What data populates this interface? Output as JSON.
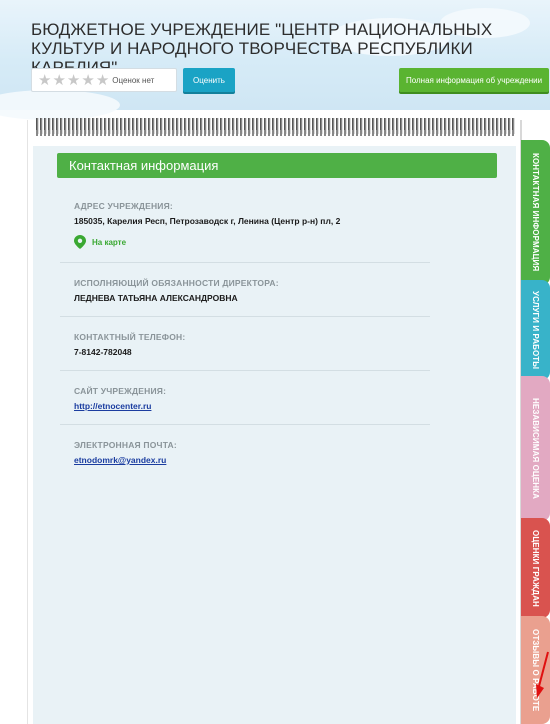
{
  "header": {
    "org_title": "БЮДЖЕТНОЕ УЧРЕЖДЕНИЕ \"ЦЕНТР НАЦИОНАЛЬНЫХ КУЛЬТУР И НАРОДНОГО ТВОРЧЕСТВА РЕСПУБЛИКИ КАРЕЛИЯ\"",
    "rating_text": "Оценок нет",
    "rating_value": 0,
    "rating_max": 5,
    "rate_button_label": "Оценить",
    "full_info_button_label": "Полная информация об учреждении"
  },
  "contact": {
    "section_title": "Контактная информация",
    "address_label": "АДРЕС УЧРЕЖДЕНИЯ:",
    "address_value": "185035, Карелия Респ, Петрозаводск г, Ленина (Центр р-н) пл, 2",
    "map_link_label": "На карте",
    "director_label": "ИСПОЛНЯЮЩИЙ ОБЯЗАННОСТИ ДИРЕКТОРА:",
    "director_value": "ЛЕДНЕВА ТАТЬЯНА АЛЕКСАНДРОВНА",
    "phone_label": "КОНТАКТНЫЙ ТЕЛЕФОН:",
    "phone_value": "7-8142-782048",
    "site_label": "САЙТ УЧРЕЖДЕНИЯ:",
    "site_value": "http://etnocenter.ru",
    "email_label": "ЭЛЕКТРОННАЯ ПОЧТА:",
    "email_value": "etnodomrk@yandex.ru"
  },
  "tabs": [
    {
      "label": "КОНТАКТНАЯ ИНФОРМАЦИЯ",
      "color": "#4fb046"
    },
    {
      "label": "УСЛУГИ И РАБОТЫ",
      "color": "#38b3c9"
    },
    {
      "label": "НЕЗАВИСИМАЯ ОЦЕНКА",
      "color": "#e2a9c2"
    },
    {
      "label": "ОЦЕНКИ ГРАЖДАН",
      "color": "#d9534f"
    },
    {
      "label": "ОТЗЫВЫ О РАБОТЕ",
      "color": "#eaa08f"
    }
  ],
  "colors": {
    "accent_green": "#4fb046",
    "accent_blue": "#1aa3c5",
    "link_blue": "#1b3da0"
  }
}
